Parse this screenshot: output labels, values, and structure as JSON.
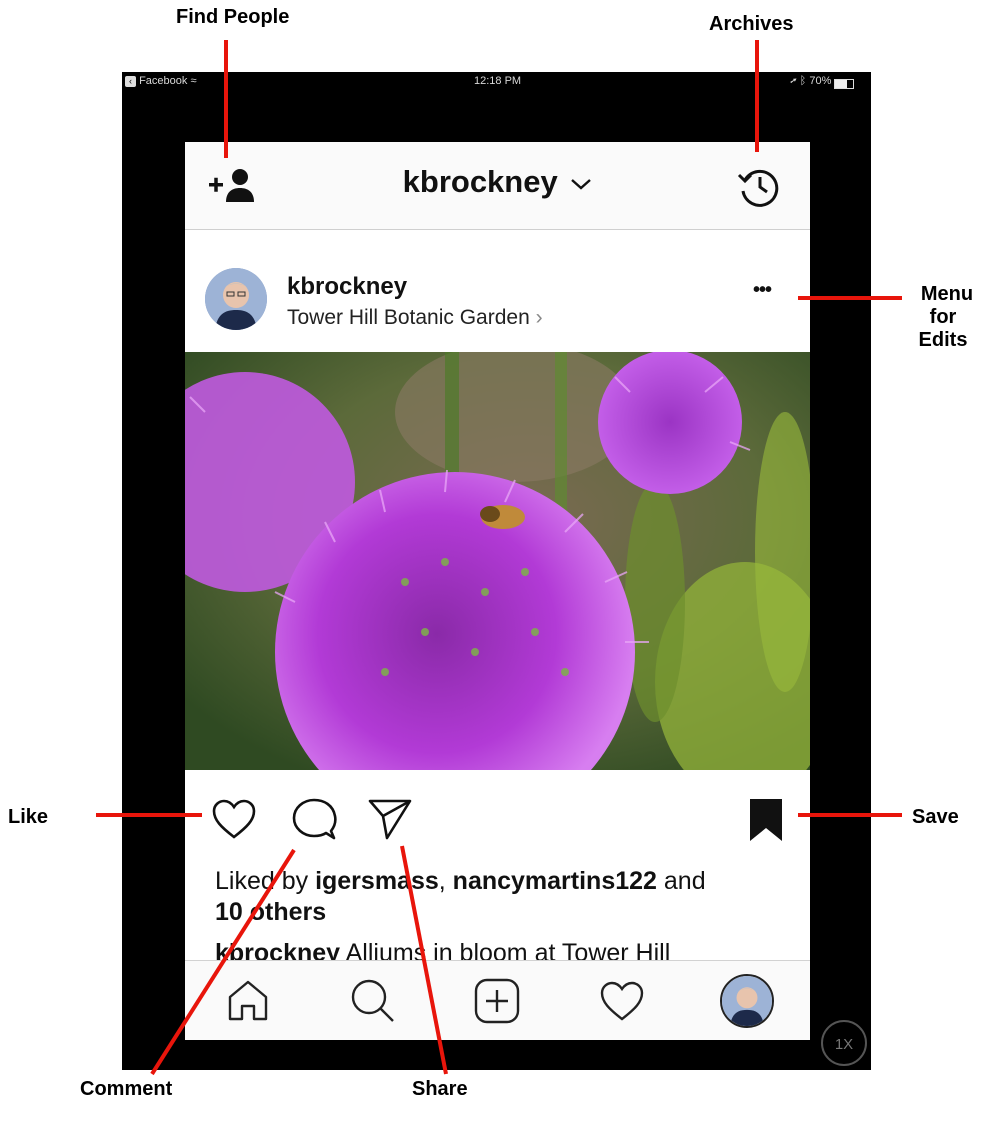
{
  "callouts": {
    "find_people": "Find People",
    "archives": "Archives",
    "menu_line1": "Menu",
    "menu_line2": "for Edits",
    "like": "Like",
    "save": "Save",
    "comment": "Comment",
    "share": "Share"
  },
  "status_bar": {
    "back_app": "Facebook",
    "time": "12:18 PM",
    "battery": "70%"
  },
  "profile_header": {
    "username": "kbrockney",
    "dropdown_glyph": "chevron-down-icon",
    "left_icon": "add-person-icon",
    "right_icon": "archive-history-icon"
  },
  "post": {
    "username": "kbrockney",
    "location": "Tower Hill Botanic Garden",
    "menu_glyph": "•••",
    "liked_prefix": "Liked by ",
    "liked_user1": "igersmass",
    "liked_sep": ", ",
    "liked_user2": "nancymartins122",
    "liked_and": " and",
    "liked_others": "10 others",
    "caption_user": "kbrockney",
    "caption_text": " Alliums in bloom at Tower Hill"
  },
  "tab_bar": [
    "home-icon",
    "search-icon",
    "new-post-icon",
    "activity-heart-icon",
    "profile-avatar-icon"
  ],
  "zoom_badge": "1X",
  "colors": {
    "callout_line": "#e8150b",
    "device_frame": "#000000",
    "allium_purple": "#b23ad6"
  }
}
